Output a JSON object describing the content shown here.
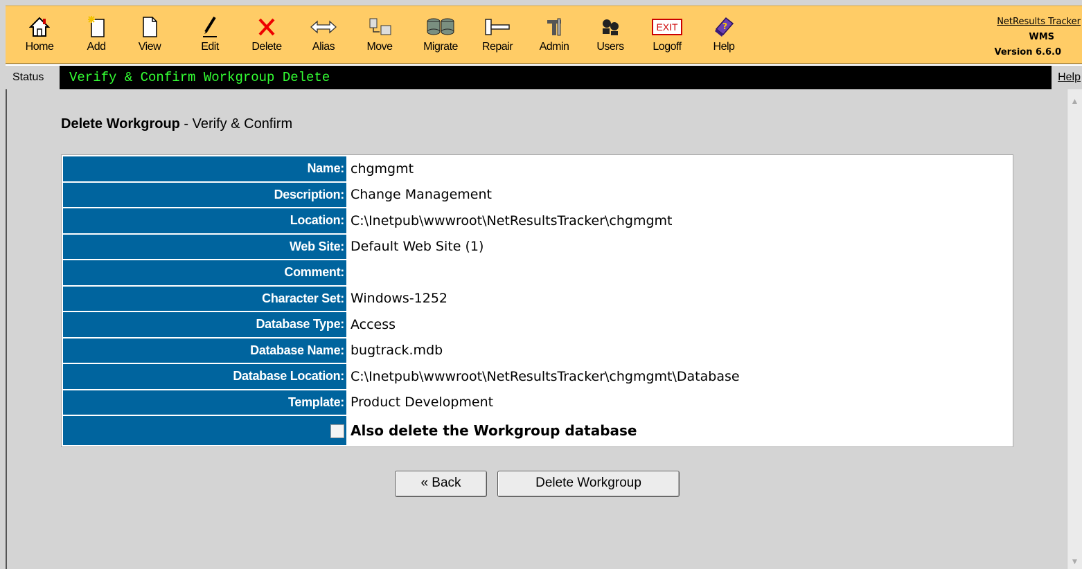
{
  "toolbar": {
    "items": [
      {
        "label": "Home",
        "icon": "home-icon"
      },
      {
        "label": "Add",
        "icon": "add-icon"
      },
      {
        "label": "View",
        "icon": "view-icon"
      },
      {
        "label": "Edit",
        "icon": "edit-icon"
      },
      {
        "label": "Delete",
        "icon": "delete-icon"
      },
      {
        "label": "Alias",
        "icon": "alias-icon"
      },
      {
        "label": "Move",
        "icon": "move-icon"
      },
      {
        "label": "Migrate",
        "icon": "migrate-icon"
      },
      {
        "label": "Repair",
        "icon": "repair-icon"
      },
      {
        "label": "Admin",
        "icon": "admin-icon"
      },
      {
        "label": "Users",
        "icon": "users-icon"
      },
      {
        "label": "Logoff",
        "icon": "logoff-icon",
        "icon_text": "EXIT"
      },
      {
        "label": "Help",
        "icon": "help-icon"
      }
    ],
    "product_name": "NetResults Tracker",
    "edition": "WMS",
    "version": "Version 6.6.0"
  },
  "status": {
    "label": "Status",
    "text": "Verify & Confirm Workgroup Delete",
    "help": "Help"
  },
  "main": {
    "heading_bold": "Delete Workgroup",
    "heading_rest": " - Verify & Confirm",
    "rows": [
      {
        "label": "Name:",
        "value": "chgmgmt"
      },
      {
        "label": "Description:",
        "value": "Change Management"
      },
      {
        "label": "Location:",
        "value": "C:\\Inetpub\\wwwroot\\NetResultsTracker\\chgmgmt"
      },
      {
        "label": "Web Site:",
        "value": "Default Web Site (1)"
      },
      {
        "label": "Comment:",
        "value": ""
      },
      {
        "label": "Character Set:",
        "value": "Windows-1252"
      },
      {
        "label": "Database Type:",
        "value": "Access"
      },
      {
        "label": "Database Name:",
        "value": "bugtrack.mdb"
      },
      {
        "label": "Database Location:",
        "value": "C:\\Inetpub\\wwwroot\\NetResultsTracker\\chgmgmt\\Database"
      },
      {
        "label": "Template:",
        "value": "Product Development"
      }
    ],
    "delete_db_label": "Also delete the Workgroup database",
    "delete_db_checked": false,
    "back_button": "« Back",
    "delete_button": "Delete Workgroup"
  },
  "colors": {
    "toolbar_bg": "#ffcc66",
    "label_bg": "#00649e",
    "status_text": "#33ff33"
  }
}
